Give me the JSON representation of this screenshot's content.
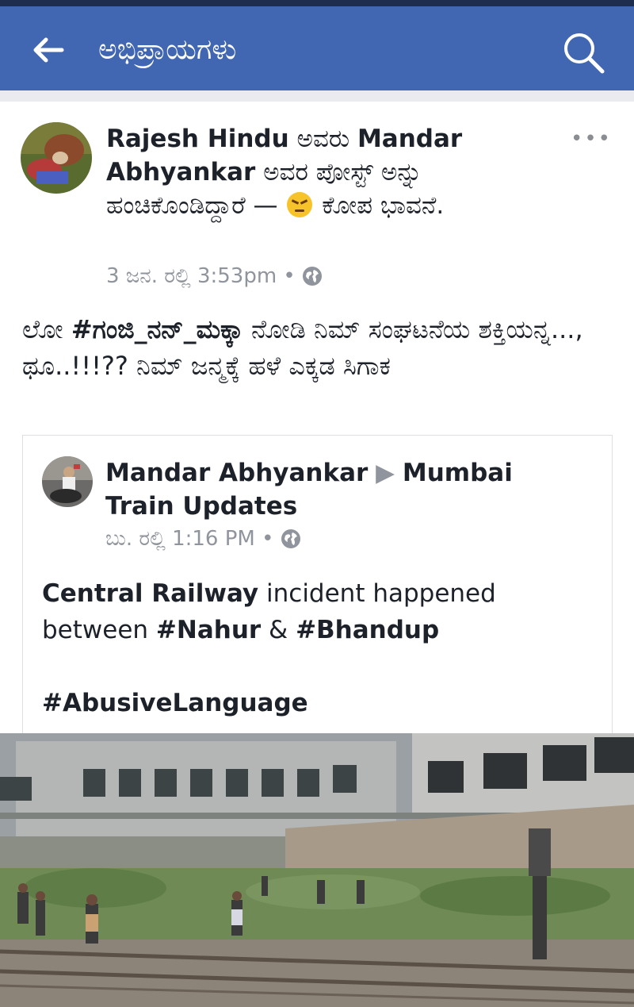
{
  "app_bar": {
    "title": "ಅಭಿಪ್ರಾಯಗಳು",
    "back_icon": "arrow-left-icon",
    "search_icon": "search-icon"
  },
  "post": {
    "author": "Rajesh Hindu",
    "connector": " ಅವರು ",
    "shared_from": "Mandar Abhyankar",
    "shared_text": " ಅವರ ಪೋಸ್ಟ್ ಅನ್ನು ಹಂಚಿಕೊಂಡಿದ್ದಾರೆ — ",
    "feeling": " ಕೋಪ ಭಾವನೆ.",
    "timestamp": "3 ಜನ. ರಲ್ಲಿ 3:53pm",
    "dot": " • ",
    "text_prefix": "ಲೋ ",
    "hashtag": "#ಗಂಜಿ_ನನ್_ಮಕ್ಕಾ",
    "text_rest": " ನೋಡಿ ನಿಮ್ ಸಂಘಟನೆಯ ಶಕ್ತಿಯನ್ನ..., ಥೂ..!!!?? ನಿಮ್ ಜನ್ಮಕ್ಕೆ ಹಳೆ ಎಕ್ಕಡ ಸಿಗಾಕ",
    "more_label": "•••"
  },
  "shared_post": {
    "author": "Mandar Abhyankar",
    "arrow": " ▶ ",
    "group": "Mumbai Train Updates",
    "timestamp": "ಬು. ರಲ್ಲಿ 1:16 PM",
    "dot": " • ",
    "line1_bold": "Central Railway",
    "line1_rest": "  incident happened",
    "line2_prefix": "between ",
    "tag1": "#Nahur",
    "amp": " & ",
    "tag2": "#Bhandup",
    "tag3": "#AbusiveLanguage"
  },
  "colors": {
    "app_bar": "#4267b2",
    "meta_gray": "#90949c",
    "text": "#1d2129"
  }
}
